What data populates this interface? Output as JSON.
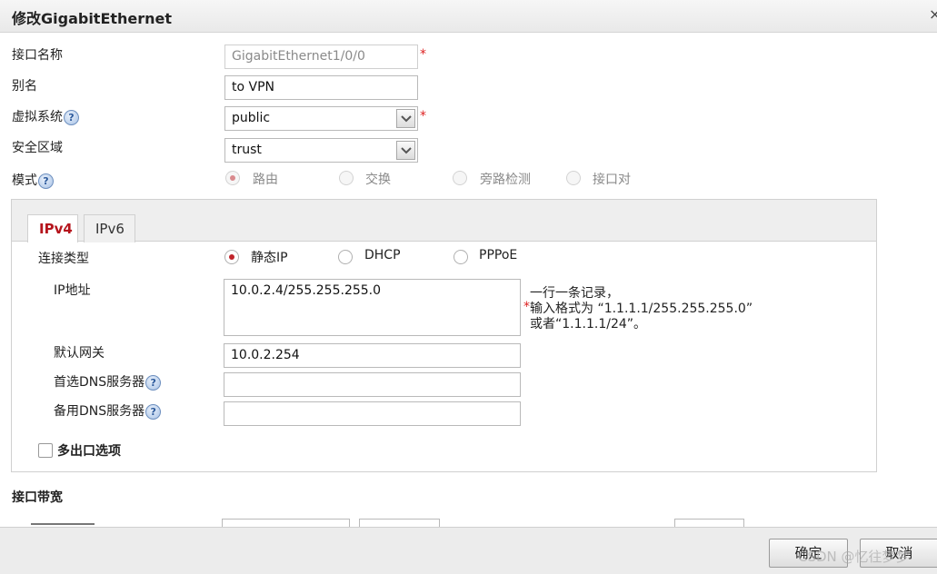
{
  "dialog": {
    "title": "修改GigabitEthernet",
    "close_glyph": "×"
  },
  "form": {
    "interface_name_label": "接口名称",
    "interface_name_value": "GigabitEthernet1/0/0",
    "alias_label": "别名",
    "alias_value": "to VPN",
    "vsys_label": "虚拟系统",
    "vsys_value": "public",
    "zone_label": "安全区域",
    "zone_value": "trust",
    "mode_label": "模式",
    "mode_options": [
      "路由",
      "交换",
      "旁路检测",
      "接口对"
    ],
    "mode_selected": "路由",
    "required_mark": "*",
    "help_glyph": "?"
  },
  "tabs": [
    "IPv4",
    "IPv6"
  ],
  "active_tab": "IPv4",
  "ipv4": {
    "conn_type_label": "连接类型",
    "conn_options": [
      "静态IP",
      "DHCP",
      "PPPoE"
    ],
    "conn_selected": "静态IP",
    "ip_label": "IP地址",
    "ip_value": "10.0.2.4/255.255.255.0",
    "ip_hint_line1": "一行一条记录，",
    "ip_hint_line2": "输入格式为 “1.1.1.1/255.255.255.0”",
    "ip_hint_line3": "或者“1.1.1.1/24”。",
    "gateway_label": "默认网关",
    "gateway_value": "10.0.2.254",
    "dns1_label": "首选DNS服务器",
    "dns1_value": "",
    "dns2_label": "备用DNS服务器",
    "dns2_value": "",
    "multi_exit_label": "多出口选项",
    "multi_exit_checked": false
  },
  "bandwidth": {
    "section_title": "接口带宽"
  },
  "footer": {
    "ok_label": "确定",
    "cancel_label": "取消"
  },
  "watermark": "CSDN @忆往梦梦",
  "colors": {
    "accent": "#c0232a",
    "required": "#dd2222",
    "help_icon": "#6d8fbf"
  }
}
